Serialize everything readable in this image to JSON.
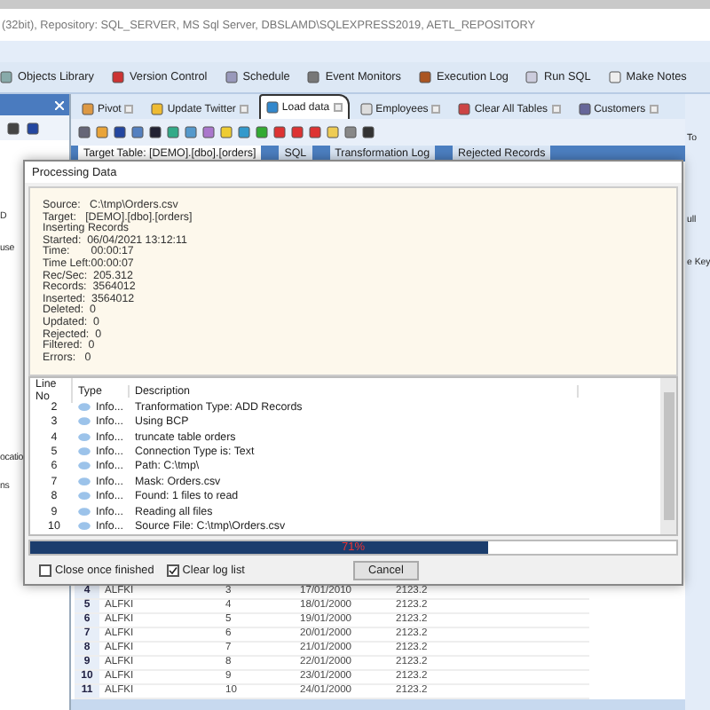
{
  "title_bar": "(32bit), Repository: SQL_SERVER, MS Sql Server, DBSLAMD\\SQLEXPRESS2019, AETL_REPOSITORY",
  "menu": [
    {
      "label": "Objects Library"
    },
    {
      "label": "Version Control"
    },
    {
      "label": "Schedule"
    },
    {
      "label": "Event Monitors"
    },
    {
      "label": "Execution Log"
    },
    {
      "label": "Run SQL"
    },
    {
      "label": "Make Notes"
    }
  ],
  "doc_tabs": [
    {
      "label": "Pivot",
      "selected": false
    },
    {
      "label": "Update Twitter",
      "selected": false
    },
    {
      "label": "Load data",
      "selected": true
    },
    {
      "label": "Employees",
      "selected": false
    },
    {
      "label": "Clear All Tables",
      "selected": false
    },
    {
      "label": "Customers",
      "selected": false
    }
  ],
  "sub_tabs": [
    {
      "label": "Target Table: [DEMO].[dbo].[orders]",
      "selected": true
    },
    {
      "label": "SQL",
      "selected": false
    },
    {
      "label": "Transformation Log",
      "selected": false
    },
    {
      "label": "Rejected Records",
      "selected": false
    }
  ],
  "left_fragments": [
    "D",
    "use",
    "ocatio",
    "ns"
  ],
  "right_fragments": [
    "To",
    "ull",
    "e Key"
  ],
  "dialog": {
    "title": "Processing Data",
    "info_lines": [
      "Source:   C:\\tmp\\Orders.csv",
      "Target:   [DEMO].[dbo].[orders]",
      "Inserting Records",
      "Started:  06/04/2021 13:12:11",
      "Time:       00:00:17",
      "Time Left:00:00:07",
      "Rec/Sec:  205.312",
      "Records:  3564012",
      "Inserted:  3564012",
      "Deleted:  0",
      "Updated:  0",
      "Rejected:  0",
      "Filtered:  0",
      "Errors:   0"
    ],
    "log_columns": [
      "Line No",
      "Type",
      "Description"
    ],
    "log_rows": [
      {
        "line": "2",
        "type": "Info...",
        "description": "Tranformation Type: ADD Records"
      },
      {
        "line": "3",
        "type": "Info...",
        "description": "Using BCP"
      },
      {
        "line": "4",
        "type": "Info...",
        "description": "truncate table orders"
      },
      {
        "line": "5",
        "type": "Info...",
        "description": "Connection Type is: Text"
      },
      {
        "line": "6",
        "type": "Info...",
        "description": "Path: C:\\tmp\\"
      },
      {
        "line": "7",
        "type": "Info...",
        "description": "Mask: Orders.csv"
      },
      {
        "line": "8",
        "type": "Info...",
        "description": "Found: 1 files to read"
      },
      {
        "line": "9",
        "type": "Info...",
        "description": "Reading all files"
      },
      {
        "line": "10",
        "type": "Info...",
        "description": "Source File: C:\\tmp\\Orders.csv"
      }
    ],
    "progress": {
      "level": 0.71,
      "label": "71%"
    },
    "options": [
      {
        "label": "Close once finished",
        "checked": false
      },
      {
        "label": "Clear log list",
        "checked": true
      }
    ],
    "cancel_button": "Cancel"
  },
  "grid_rows": [
    {
      "row": "4",
      "customer": "ALFKI",
      "order": "3",
      "date": "17/01/2010",
      "amount": "2123.2"
    },
    {
      "row": "5",
      "customer": "ALFKI",
      "order": "4",
      "date": "18/01/2000",
      "amount": "2123.2"
    },
    {
      "row": "6",
      "customer": "ALFKI",
      "order": "5",
      "date": "19/01/2000",
      "amount": "2123.2"
    },
    {
      "row": "7",
      "customer": "ALFKI",
      "order": "6",
      "date": "20/01/2000",
      "amount": "2123.2"
    },
    {
      "row": "8",
      "customer": "ALFKI",
      "order": "7",
      "date": "21/01/2000",
      "amount": "2123.2"
    },
    {
      "row": "9",
      "customer": "ALFKI",
      "order": "8",
      "date": "22/01/2000",
      "amount": "2123.2"
    },
    {
      "row": "10",
      "customer": "ALFKI",
      "order": "9",
      "date": "23/01/2000",
      "amount": "2123.2"
    },
    {
      "row": "11",
      "customer": "ALFKI",
      "order": "10",
      "date": "24/01/2000",
      "amount": "2123.2"
    }
  ]
}
